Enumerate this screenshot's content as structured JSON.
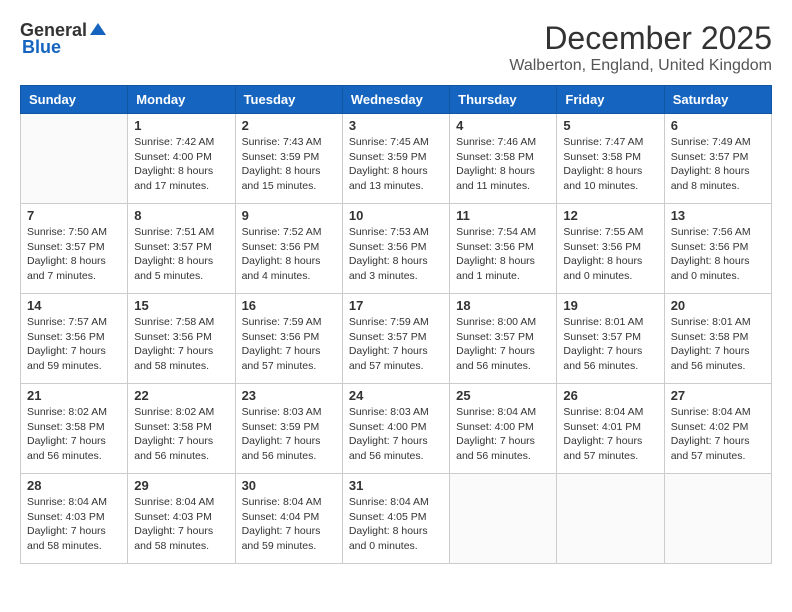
{
  "header": {
    "logo_general": "General",
    "logo_blue": "Blue",
    "title": "December 2025",
    "location": "Walberton, England, United Kingdom"
  },
  "days_of_week": [
    "Sunday",
    "Monday",
    "Tuesday",
    "Wednesday",
    "Thursday",
    "Friday",
    "Saturday"
  ],
  "weeks": [
    [
      {
        "day": "",
        "content": ""
      },
      {
        "day": "1",
        "content": "Sunrise: 7:42 AM\nSunset: 4:00 PM\nDaylight: 8 hours\nand 17 minutes."
      },
      {
        "day": "2",
        "content": "Sunrise: 7:43 AM\nSunset: 3:59 PM\nDaylight: 8 hours\nand 15 minutes."
      },
      {
        "day": "3",
        "content": "Sunrise: 7:45 AM\nSunset: 3:59 PM\nDaylight: 8 hours\nand 13 minutes."
      },
      {
        "day": "4",
        "content": "Sunrise: 7:46 AM\nSunset: 3:58 PM\nDaylight: 8 hours\nand 11 minutes."
      },
      {
        "day": "5",
        "content": "Sunrise: 7:47 AM\nSunset: 3:58 PM\nDaylight: 8 hours\nand 10 minutes."
      },
      {
        "day": "6",
        "content": "Sunrise: 7:49 AM\nSunset: 3:57 PM\nDaylight: 8 hours\nand 8 minutes."
      }
    ],
    [
      {
        "day": "7",
        "content": "Sunrise: 7:50 AM\nSunset: 3:57 PM\nDaylight: 8 hours\nand 7 minutes."
      },
      {
        "day": "8",
        "content": "Sunrise: 7:51 AM\nSunset: 3:57 PM\nDaylight: 8 hours\nand 5 minutes."
      },
      {
        "day": "9",
        "content": "Sunrise: 7:52 AM\nSunset: 3:56 PM\nDaylight: 8 hours\nand 4 minutes."
      },
      {
        "day": "10",
        "content": "Sunrise: 7:53 AM\nSunset: 3:56 PM\nDaylight: 8 hours\nand 3 minutes."
      },
      {
        "day": "11",
        "content": "Sunrise: 7:54 AM\nSunset: 3:56 PM\nDaylight: 8 hours\nand 1 minute."
      },
      {
        "day": "12",
        "content": "Sunrise: 7:55 AM\nSunset: 3:56 PM\nDaylight: 8 hours\nand 0 minutes."
      },
      {
        "day": "13",
        "content": "Sunrise: 7:56 AM\nSunset: 3:56 PM\nDaylight: 8 hours\nand 0 minutes."
      }
    ],
    [
      {
        "day": "14",
        "content": "Sunrise: 7:57 AM\nSunset: 3:56 PM\nDaylight: 7 hours\nand 59 minutes."
      },
      {
        "day": "15",
        "content": "Sunrise: 7:58 AM\nSunset: 3:56 PM\nDaylight: 7 hours\nand 58 minutes."
      },
      {
        "day": "16",
        "content": "Sunrise: 7:59 AM\nSunset: 3:56 PM\nDaylight: 7 hours\nand 57 minutes."
      },
      {
        "day": "17",
        "content": "Sunrise: 7:59 AM\nSunset: 3:57 PM\nDaylight: 7 hours\nand 57 minutes."
      },
      {
        "day": "18",
        "content": "Sunrise: 8:00 AM\nSunset: 3:57 PM\nDaylight: 7 hours\nand 56 minutes."
      },
      {
        "day": "19",
        "content": "Sunrise: 8:01 AM\nSunset: 3:57 PM\nDaylight: 7 hours\nand 56 minutes."
      },
      {
        "day": "20",
        "content": "Sunrise: 8:01 AM\nSunset: 3:58 PM\nDaylight: 7 hours\nand 56 minutes."
      }
    ],
    [
      {
        "day": "21",
        "content": "Sunrise: 8:02 AM\nSunset: 3:58 PM\nDaylight: 7 hours\nand 56 minutes."
      },
      {
        "day": "22",
        "content": "Sunrise: 8:02 AM\nSunset: 3:58 PM\nDaylight: 7 hours\nand 56 minutes."
      },
      {
        "day": "23",
        "content": "Sunrise: 8:03 AM\nSunset: 3:59 PM\nDaylight: 7 hours\nand 56 minutes."
      },
      {
        "day": "24",
        "content": "Sunrise: 8:03 AM\nSunset: 4:00 PM\nDaylight: 7 hours\nand 56 minutes."
      },
      {
        "day": "25",
        "content": "Sunrise: 8:04 AM\nSunset: 4:00 PM\nDaylight: 7 hours\nand 56 minutes."
      },
      {
        "day": "26",
        "content": "Sunrise: 8:04 AM\nSunset: 4:01 PM\nDaylight: 7 hours\nand 57 minutes."
      },
      {
        "day": "27",
        "content": "Sunrise: 8:04 AM\nSunset: 4:02 PM\nDaylight: 7 hours\nand 57 minutes."
      }
    ],
    [
      {
        "day": "28",
        "content": "Sunrise: 8:04 AM\nSunset: 4:03 PM\nDaylight: 7 hours\nand 58 minutes."
      },
      {
        "day": "29",
        "content": "Sunrise: 8:04 AM\nSunset: 4:03 PM\nDaylight: 7 hours\nand 58 minutes."
      },
      {
        "day": "30",
        "content": "Sunrise: 8:04 AM\nSunset: 4:04 PM\nDaylight: 7 hours\nand 59 minutes."
      },
      {
        "day": "31",
        "content": "Sunrise: 8:04 AM\nSunset: 4:05 PM\nDaylight: 8 hours\nand 0 minutes."
      },
      {
        "day": "",
        "content": ""
      },
      {
        "day": "",
        "content": ""
      },
      {
        "day": "",
        "content": ""
      }
    ]
  ]
}
